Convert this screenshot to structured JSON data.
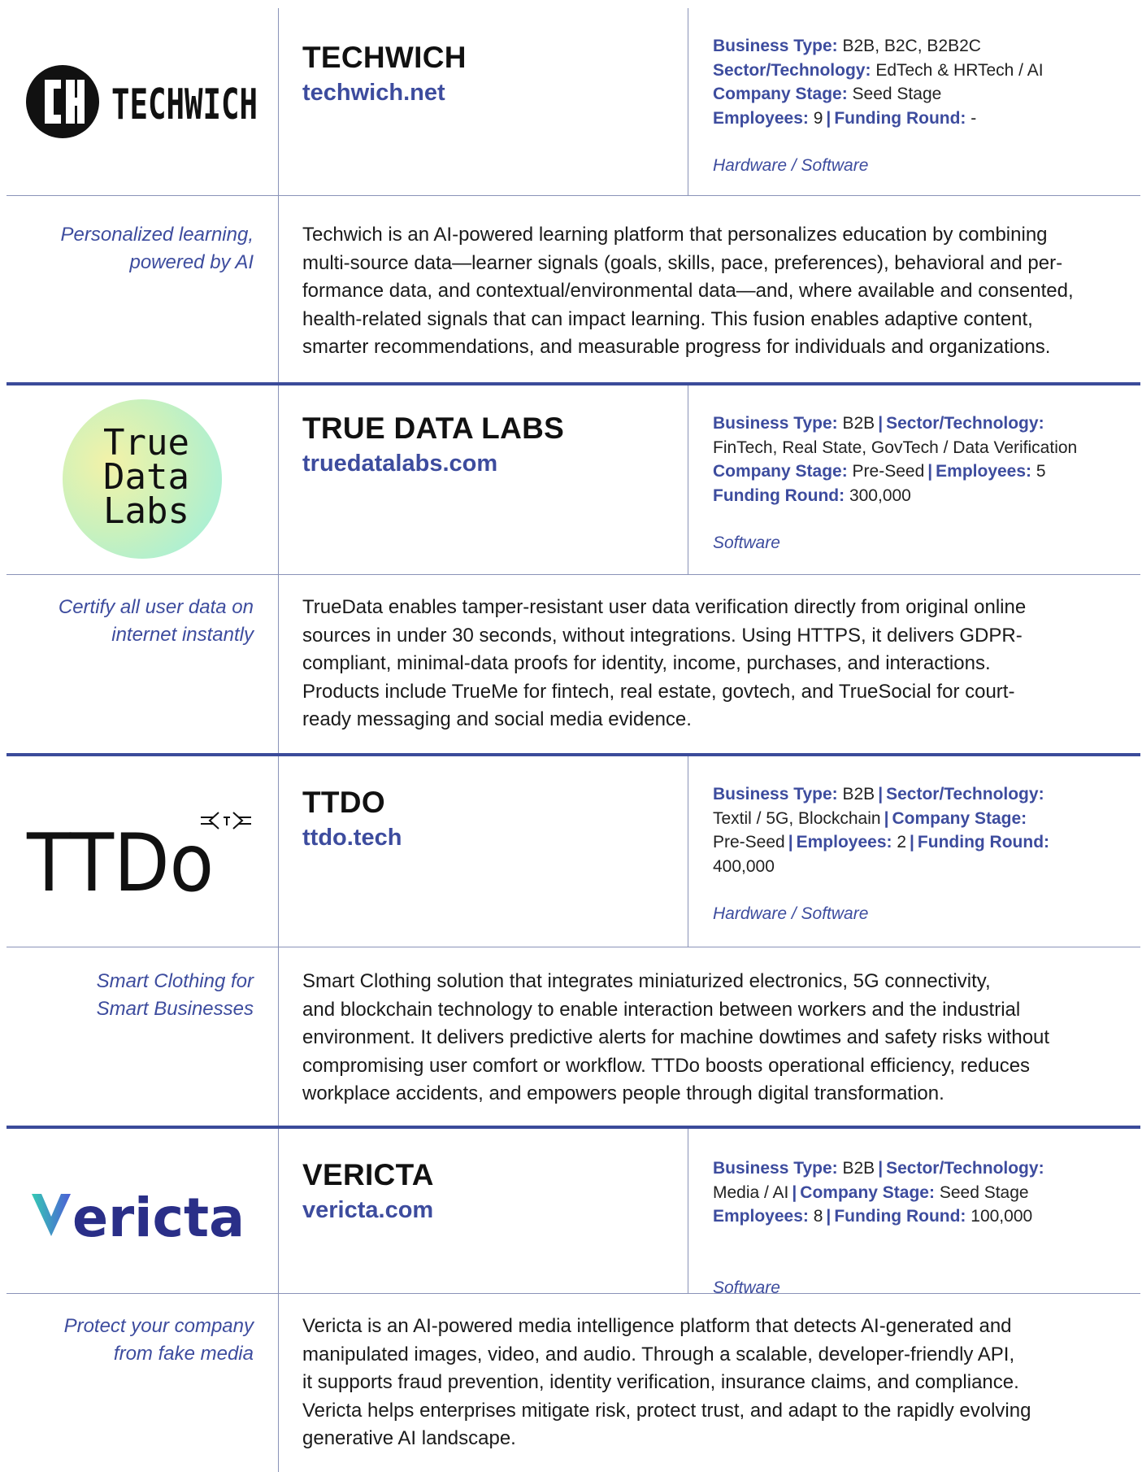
{
  "companies": [
    {
      "name": "TECHWICH",
      "url": "techwich.net",
      "logo_text": "TECHWICH",
      "meta_lines": [
        [
          {
            "k": "Business Type:",
            "v": "B2B, B2C, B2B2C"
          }
        ],
        [
          {
            "k": "Sector/Technology:",
            "v": "EdTech & HRTech / AI"
          }
        ],
        [
          {
            "k": "Company Stage:",
            "v": "Seed Stage"
          }
        ],
        [
          {
            "k": "Employees:",
            "v": "9"
          },
          {
            "k": "Funding Round:",
            "v": "-"
          }
        ]
      ],
      "category": "Hardware / Software",
      "tagline": [
        "Personalized learning,",
        "powered by AI"
      ],
      "description": [
        "Techwich is an AI-powered learning platform that personalizes education by combining",
        "multi-source data—learner signals (goals, skills, pace, preferences), behavioral and per-",
        "formance data, and contextual/environmental data—and, where available and consented,",
        "health-related signals that can impact learning. This fusion enables adaptive content,",
        "smarter recommendations, and measurable progress for individuals and organizations."
      ]
    },
    {
      "name": "TRUE DATA LABS",
      "url": "truedatalabs.com",
      "logo_text": [
        "True",
        "Data",
        "Labs"
      ],
      "meta_lines": [
        [
          {
            "k": "Business Type:",
            "v": "B2B"
          },
          {
            "k": "Sector/Technology:",
            "v": ""
          }
        ],
        [
          {
            "k": "",
            "v": "FinTech, Real State, GovTech / Data Verification"
          }
        ],
        [
          {
            "k": "Company Stage:",
            "v": "Pre-Seed"
          },
          {
            "k": "Employees:",
            "v": "5"
          }
        ],
        [
          {
            "k": "Funding Round:",
            "v": "300,000"
          }
        ]
      ],
      "category": "Software",
      "tagline": [
        "Certify all user data on",
        "internet instantly"
      ],
      "description": [
        "TrueData enables tamper-resistant user data verification directly from original online",
        "sources in under 30 seconds, without integrations. Using HTTPS, it delivers GDPR-",
        "compliant, minimal-data proofs for identity, income, purchases, and interactions.",
        "Products include TrueMe for fintech, real estate, govtech, and TrueSocial for court-",
        "ready messaging and social media evidence."
      ]
    },
    {
      "name": "TTDO",
      "url": "ttdo.tech",
      "logo_text": "TTDo",
      "meta_lines": [
        [
          {
            "k": "Business Type:",
            "v": "B2B"
          },
          {
            "k": "Sector/Technology:",
            "v": ""
          }
        ],
        [
          {
            "k": "",
            "v": "Textil / 5G, Blockchain"
          },
          {
            "k": "Company Stage:",
            "v": ""
          }
        ],
        [
          {
            "k": "",
            "v": "Pre-Seed"
          },
          {
            "k": "Employees:",
            "v": "2"
          },
          {
            "k": "Funding Round:",
            "v": ""
          }
        ],
        [
          {
            "k": "",
            "v": "400,000"
          }
        ]
      ],
      "category": "Hardware / Software",
      "tagline": [
        "Smart Clothing for",
        "Smart Businesses"
      ],
      "description": [
        "Smart Clothing solution that integrates miniaturized electronics, 5G connectivity,",
        "and blockchain technology to enable interaction between workers and the industrial",
        "environment. It delivers predictive alerts for machine dowtimes and safety risks without",
        "compromising user comfort or workflow. TTDo boosts operational efficiency, reduces",
        "workplace accidents, and empowers people through digital transformation."
      ]
    },
    {
      "name": "VERICTA",
      "url": "vericta.com",
      "logo_text": "vericta",
      "meta_lines": [
        [
          {
            "k": "Business Type:",
            "v": "B2B"
          },
          {
            "k": "Sector/Technology:",
            "v": ""
          }
        ],
        [
          {
            "k": "",
            "v": "Media / AI"
          },
          {
            "k": "Company Stage:",
            "v": "Seed Stage"
          }
        ],
        [
          {
            "k": "Employees:",
            "v": "8"
          },
          {
            "k": "Funding Round:",
            "v": "100,000"
          }
        ]
      ],
      "category": "Software",
      "tagline": [
        "Protect your company",
        "from fake media"
      ],
      "description": [
        "Vericta is an AI-powered media intelligence platform that detects AI-generated and",
        "manipulated images, video, and audio. Through a scalable, developer-friendly API,",
        "it supports fraud prevention, identity verification, insurance claims, and compliance.",
        "Vericta helps enterprises mitigate risk, protect trust, and adapt to the rapidly evolving",
        "generative AI landscape."
      ]
    }
  ],
  "colors": {
    "accent": "#3d4c9e",
    "rule": "#8a93b8",
    "text": "#1a1a1a"
  }
}
